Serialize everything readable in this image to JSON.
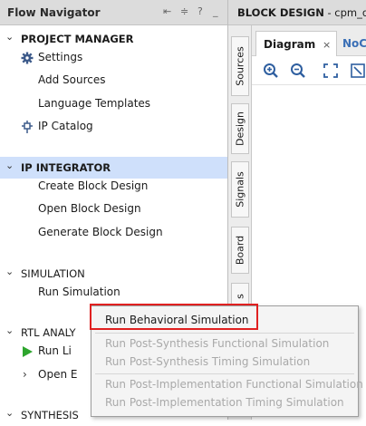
{
  "flow_navigator": {
    "title": "Flow Navigator",
    "controls": {
      "collapse": "⇤",
      "expand": "≑",
      "help": "?",
      "minimize": "_"
    },
    "sections": [
      {
        "label": "PROJECT MANAGER",
        "expanded": true,
        "items": [
          {
            "label": "Settings",
            "icon": "gear-icon"
          },
          {
            "label": "Add Sources"
          },
          {
            "label": "Language Templates"
          },
          {
            "label": "IP Catalog",
            "icon": "ip-plug-icon"
          }
        ]
      },
      {
        "label": "IP INTEGRATOR",
        "expanded": true,
        "selected": true,
        "items": [
          {
            "label": "Create Block Design"
          },
          {
            "label": "Open Block Design"
          },
          {
            "label": "Generate Block Design"
          }
        ]
      },
      {
        "label": "SIMULATION",
        "expanded": true,
        "items": [
          {
            "label": "Run Simulation"
          }
        ]
      },
      {
        "label": "RTL ANALY",
        "expanded": true,
        "items": [
          {
            "label": "Run Li",
            "icon": "play-icon"
          },
          {
            "label": "Open E",
            "chevron": "›"
          }
        ]
      },
      {
        "label": "SYNTHESIS",
        "expanded": true
      }
    ]
  },
  "block_design": {
    "title": "BLOCK DESIGN",
    "subtitle": " - cpm_q",
    "side_tabs": [
      "Sources",
      "Design",
      "Signals",
      "Board",
      "s"
    ],
    "tabs": [
      {
        "label": "Diagram",
        "close": "×",
        "active": true
      },
      {
        "label": "NoC"
      }
    ],
    "toolbar": [
      "zoom-in-icon",
      "zoom-out-icon",
      "fit-view-icon",
      "auto-fit-icon"
    ]
  },
  "context_menu": {
    "items": [
      {
        "label": "Run Behavioral Simulation",
        "enabled": true,
        "highlighted": true
      },
      {
        "label": "Run Post-Synthesis Functional Simulation",
        "enabled": false
      },
      {
        "label": "Run Post-Synthesis Timing Simulation",
        "enabled": false
      },
      {
        "label": "Run Post-Implementation Functional Simulation",
        "enabled": false
      },
      {
        "label": "Run Post-Implementation Timing Simulation",
        "enabled": false
      }
    ]
  },
  "colors": {
    "selected_section": "#cfe0fb",
    "highlight_box": "#e02020",
    "header_bg": "#dcdcdc",
    "play_green": "#2ea52e",
    "disabled_text": "#a9a9a9"
  }
}
